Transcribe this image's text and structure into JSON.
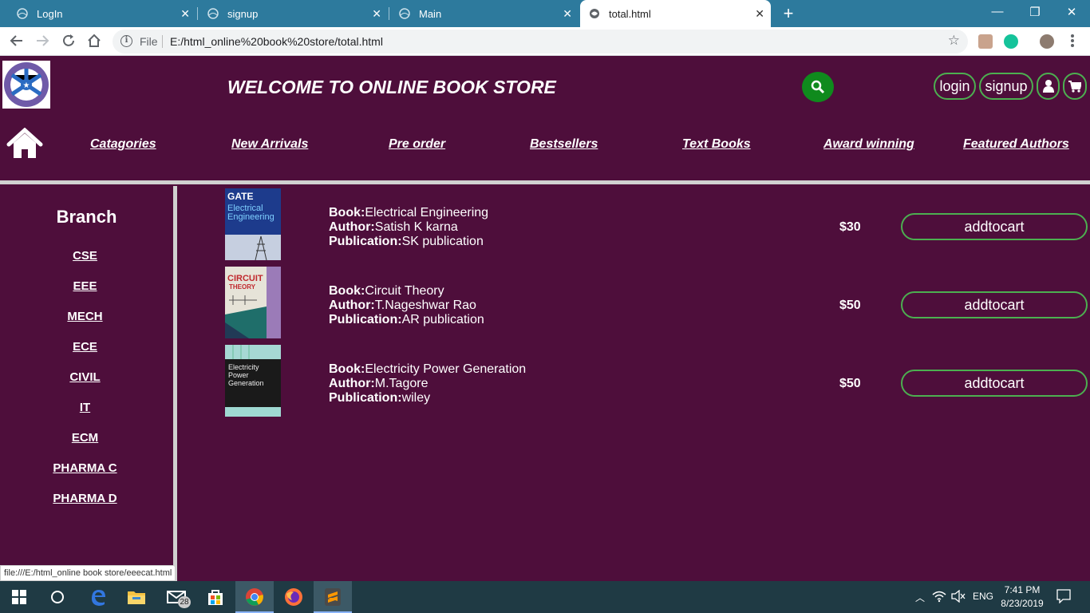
{
  "browser": {
    "tabs": [
      {
        "title": "LogIn"
      },
      {
        "title": "signup"
      },
      {
        "title": "Main"
      },
      {
        "title": "total.html"
      }
    ],
    "active_tab": 3,
    "omnibox": {
      "scheme_label": "File",
      "url": "E:/html_online%20book%20store/total.html"
    },
    "status_url": "file:///E:/html_online book store/eeecat.html"
  },
  "site": {
    "welcome": "WELCOME TO ONLINE BOOK STORE",
    "login_label": "login",
    "signup_label": "signup",
    "nav": [
      "Catagories",
      "New Arrivals",
      "Pre order",
      "Bestsellers",
      "Text Books",
      "Award winning",
      "Featured Authors"
    ],
    "sidebar": {
      "title": "Branch",
      "items": [
        "CSE",
        "EEE",
        "MECH",
        "ECE",
        "CIVIL",
        "IT",
        "ECM",
        "PHARMA C",
        "PHARMA D"
      ]
    },
    "labels": {
      "book": "Book:",
      "author": "Author:",
      "publication": "Publication:",
      "add": "addtocart"
    },
    "books": [
      {
        "title": "Electrical Engineering",
        "author": "Satish K karna",
        "publication": "SK publication",
        "price": "$30",
        "cover": {
          "line1": "GATE",
          "line2": "Electrical",
          "line3": "Engineering"
        }
      },
      {
        "title": "Circuit Theory",
        "author": "T.Nageshwar Rao",
        "publication": "AR publication",
        "price": "$50",
        "cover": {
          "line1": "CIRCUIT",
          "line2": "THEORY"
        }
      },
      {
        "title": "Electricity Power Generation",
        "author": "M.Tagore",
        "publication": "wiley",
        "price": "$50",
        "cover": {
          "line1": "Electricity",
          "line2": "Power",
          "line3": "Generation"
        }
      }
    ]
  },
  "taskbar": {
    "mail_badge": "28",
    "lang": "ENG",
    "time": "7:41 PM",
    "date": "8/23/2019"
  },
  "colors": {
    "accent_green": "#4caf50",
    "bg_purple": "#4e0e3b",
    "tabbar_blue": "#2d7a9d"
  }
}
